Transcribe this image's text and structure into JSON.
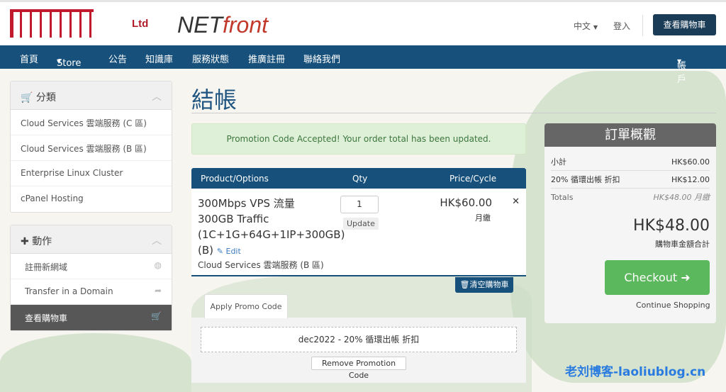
{
  "header": {
    "logo_text": "Ltd",
    "brand_black": "NET",
    "brand_red": "front",
    "language": "中文",
    "login": "登入",
    "view_cart": "查看購物車"
  },
  "nav": {
    "items": [
      "首頁",
      "Store",
      "公告",
      "知識庫",
      "服務狀態",
      "推廣註冊",
      "聯絡我們"
    ],
    "account": "帳戶"
  },
  "sidebar": {
    "categories": {
      "title": "分類",
      "items": [
        "Cloud Services 雲端服務 (C 區)",
        "Cloud Services 雲端服務 (B 區)",
        "Enterprise Linux Cluster",
        "cPanel Hosting"
      ]
    },
    "actions": {
      "title": "動作",
      "items": [
        "註冊新網域",
        "Transfer in a Domain",
        "查看購物車"
      ]
    }
  },
  "main": {
    "title": "結帳",
    "alert": "Promotion Code Accepted! Your order total has been updated.",
    "table": {
      "headers": [
        "Product/Options",
        "Qty",
        "Price/Cycle"
      ],
      "item": {
        "name_lines": [
          "300Mbps VPS 流量",
          "300GB Traffic",
          "(1C+1G+64G+1IP+300GB)",
          "(B)"
        ],
        "edit": "Edit",
        "group": "Cloud Services 雲端服務 (B 區)",
        "qty": "1",
        "update": "Update",
        "price": "HK$60.00",
        "cycle": "月繳"
      }
    },
    "empty_cart": "清空購物車",
    "promo": {
      "tab": "Apply Promo Code",
      "applied": "dec2022 - 20% 循環出帳 折扣",
      "remove": "Remove Promotion Code"
    }
  },
  "summary": {
    "title": "訂單概觀",
    "subtotal_label": "小計",
    "subtotal": "HK$60.00",
    "discount_label": "20% 循環出帳 折扣",
    "discount": "HK$12.00",
    "totals_label": "Totals",
    "totals": "HK$48.00 月繳",
    "total": "HK$48.00",
    "total_label": "購物車金額合計",
    "checkout": "Checkout",
    "continue": "Continue Shopping"
  },
  "watermark": "老刘博客-laoliublog.cn",
  "colors": {
    "nav": "#17507a",
    "checkout": "#5cb85c",
    "alert_bg": "#dff0d8"
  }
}
